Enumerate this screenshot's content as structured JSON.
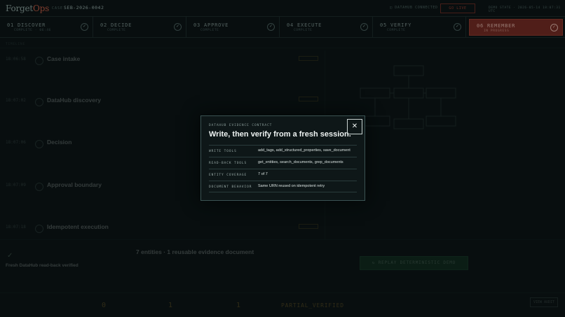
{
  "app": {
    "logo_main": "Forget",
    "logo_accent": "Ops"
  },
  "header": {
    "case_label": "CASE",
    "case_id": "SEB-2026-0042",
    "connection": "DATAHUB CONNECTED",
    "live_button": "GO LIVE",
    "clock": "DEMO STATE · 2026-05-14 18:07:31 UTC"
  },
  "steps": [
    {
      "num": "01 DISCOVER",
      "sub": "COMPLETE · 06:46",
      "check": "✓"
    },
    {
      "num": "02 DECIDE",
      "sub": "COMPLETE",
      "check": "✓"
    },
    {
      "num": "03 APPROVE",
      "sub": "COMPLETE",
      "check": "✓"
    },
    {
      "num": "04 EXECUTE",
      "sub": "COMPLETE",
      "check": "✓"
    },
    {
      "num": "05 VERIFY",
      "sub": "COMPLETE",
      "check": "✓"
    },
    {
      "num": "06 REMEMBER",
      "sub": "IN PROGRESS",
      "check": "✓"
    }
  ],
  "timeline": {
    "header": "TIMELINE",
    "items": [
      {
        "time": "18:06:58",
        "title": "Case intake"
      },
      {
        "time": "18:07:02",
        "title": "DataHub discovery"
      },
      {
        "time": "18:07:06",
        "title": "Decision"
      },
      {
        "time": "18:07:09",
        "title": "Approval boundary"
      },
      {
        "time": "18:07:18",
        "title": "Idempotent execution"
      }
    ]
  },
  "bottom": {
    "status_title": "Fresh DataHub read-back verified",
    "summary_head": "7 entities · 1 reusable evidence document",
    "replay_label": "REPLAY DETERMINISTIC DEMO",
    "stats": [
      {
        "value": "0"
      },
      {
        "value": "1"
      },
      {
        "value": "1"
      },
      {
        "value": "PARTIAL_VERIFIED"
      }
    ],
    "view_button": "VIEW AUDIT"
  },
  "modal": {
    "kicker": "DATAHUB EVIDENCE CONTRACT",
    "title": "Write, then verify from a fresh session.",
    "close_glyph": "✕",
    "rows": [
      {
        "key": "WRITE TOOLS",
        "value": "add_tags, add_structured_properties, save_document"
      },
      {
        "key": "READ-BACK TOOLS",
        "value": "get_entities, search_documents, grep_documents"
      },
      {
        "key": "ENTITY COVERAGE",
        "value": "7 of 7"
      },
      {
        "key": "DOCUMENT BEHAVIOR",
        "value": "Same URN reused on idempotent retry"
      }
    ]
  },
  "colors": {
    "background": "#0b1213",
    "accent_red": "#9a3b2e",
    "accent_green": "#1e5a37",
    "modal_border": "#3b5353"
  }
}
